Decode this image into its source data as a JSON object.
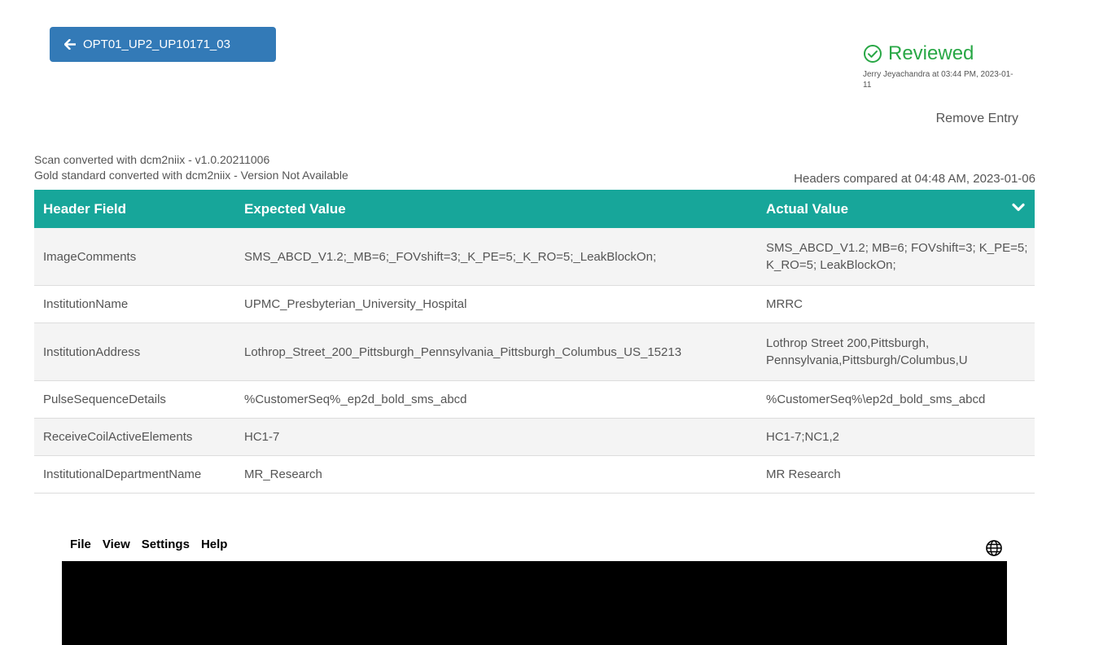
{
  "header": {
    "back_button_label": "OPT01_UP2_UP10171_03"
  },
  "review": {
    "status": "Reviewed",
    "reviewer_line": "Jerry Jeyachandra at 03:44 PM, 2023-01-11",
    "remove_label": "Remove Entry"
  },
  "conversion": {
    "scan_line": "Scan converted with dcm2niix - v1.0.20211006",
    "gold_line": "Gold standard converted with dcm2niix - Version Not Available",
    "compared_line": "Headers compared at 04:48 AM, 2023-01-06"
  },
  "table": {
    "columns": [
      "Header Field",
      "Expected Value",
      "Actual Value"
    ],
    "rows": [
      {
        "field": "ImageComments",
        "expected": "SMS_ABCD_V1.2;_MB=6;_FOVshift=3;_K_PE=5;_K_RO=5;_LeakBlockOn;",
        "actual": "SMS_ABCD_V1.2; MB=6; FOVshift=3; K_PE=5; K_RO=5; LeakBlockOn;"
      },
      {
        "field": "InstitutionName",
        "expected": "UPMC_Presbyterian_University_Hospital",
        "actual": "MRRC"
      },
      {
        "field": "InstitutionAddress",
        "expected": "Lothrop_Street_200_Pittsburgh_Pennsylvania_Pittsburgh_Columbus_US_15213",
        "actual": "Lothrop Street 200,Pittsburgh, Pennsylvania,Pittsburgh/Columbus,U"
      },
      {
        "field": "PulseSequenceDetails",
        "expected": "%CustomerSeq%_ep2d_bold_sms_abcd",
        "actual": "%CustomerSeq%\\ep2d_bold_sms_abcd"
      },
      {
        "field": "ReceiveCoilActiveElements",
        "expected": "HC1-7",
        "actual": "HC1-7;NC1,2"
      },
      {
        "field": "InstitutionalDepartmentName",
        "expected": "MR_Research",
        "actual": "MR Research"
      }
    ]
  },
  "viewer": {
    "menu": [
      "File",
      "View",
      "Settings",
      "Help"
    ]
  },
  "icons": {
    "back": "arrow-left-icon",
    "status": "check-circle-icon",
    "collapse": "chevron-down-icon",
    "language": "globe-icon"
  },
  "colors": {
    "primary_button": "#337ab7",
    "table_header": "#17a69a",
    "reviewed": "#28a745",
    "viewer_background": "#000000"
  }
}
